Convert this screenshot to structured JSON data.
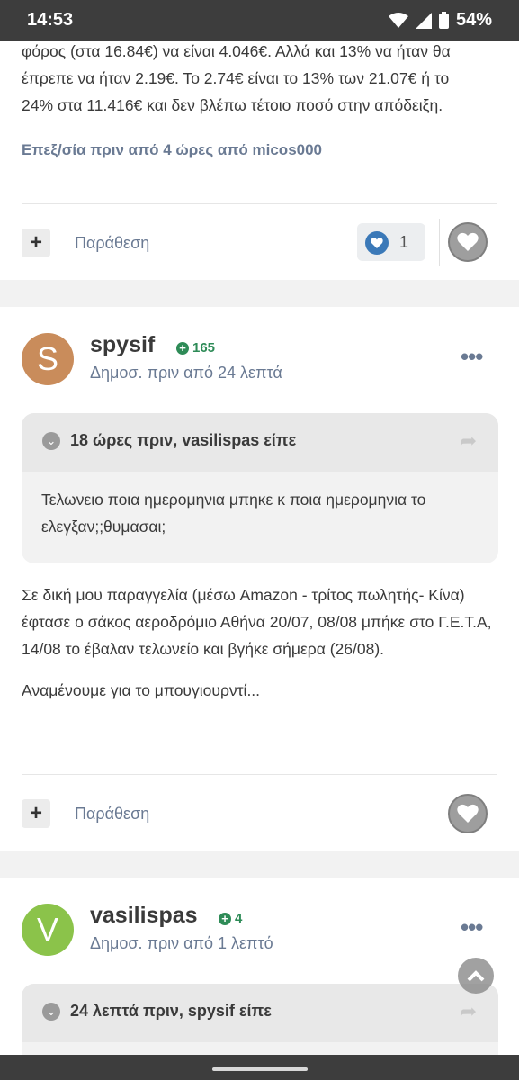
{
  "status_bar": {
    "time": "14:53",
    "battery": "54%"
  },
  "post1": {
    "text_lines": [
      "φόρος (στα 16.84€) να είναι 4.046€. Αλλά και 13% να ήταν θα",
      "έπρεπε να ήταν 2.19€. Το 2.74€ είναι το 13% των 21.07€ ή το",
      "24% στα 11.416€ και δεν βλέπω τέτοιο ποσό στην απόδειξη."
    ],
    "edited": "Επεξ/σία πριν από 4 ώρες από micos000",
    "quote_label": "Παράθεση",
    "reaction_count": "1"
  },
  "post2": {
    "avatar_letter": "S",
    "avatar_color": "#c98c5b",
    "username": "spysif",
    "reputation": "165",
    "meta": "Δημοσ. πριν από 24 λεπτά",
    "quote": {
      "title": "18 ώρες πριν, vasilispas είπε",
      "text": "Τελωνειο ποια ημερομηνια μπηκε κ ποια ημερομηνια το ελεγξαν;;θυμασαι;"
    },
    "body_p1": "Σε δική μου παραγγελία (μέσω Amazon - τρίτος πωλητής- Κίνα) έφτασε ο σάκος αεροδρόμιο Αθήνα 20/07, 08/08 μπήκε στο Γ.Ε.Τ.Α, 14/08 το έβαλαν τελωνείο και βγήκε σήμερα (26/08).",
    "body_p2": "Αναμένουμε για το μπουγιουρντί...",
    "quote_label": "Παράθεση"
  },
  "post3": {
    "avatar_letter": "V",
    "avatar_color": "#8bc34a",
    "username": "vasilispas",
    "reputation": "4",
    "meta": "Δημοσ. πριν από 1 λεπτό",
    "quote": {
      "title": "24 λεπτά πριν, spysif είπε"
    }
  },
  "colors": {
    "accent": "#6a7a93",
    "reputation": "#2e8b57",
    "reaction": "#3b79b8"
  }
}
